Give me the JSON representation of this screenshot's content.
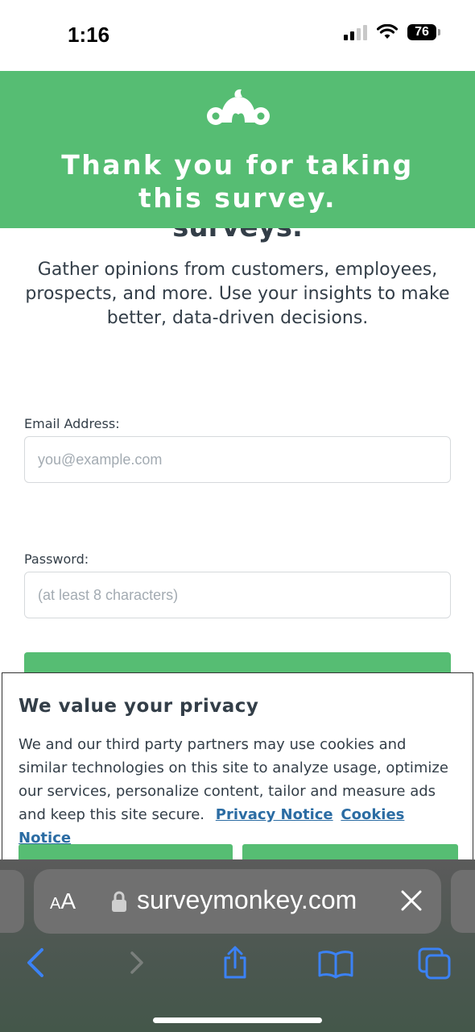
{
  "status_bar": {
    "time": "1:16",
    "battery": "76"
  },
  "header": {
    "title": "Thank you for taking this survey."
  },
  "page": {
    "cutoff_heading": "surveys.",
    "intro": "Gather opinions from customers, employees, prospects, and more. Use your insights to make better, data-driven decisions.",
    "email": {
      "label": "Email Address:",
      "placeholder": "you@example.com"
    },
    "password": {
      "label": "Password:",
      "placeholder": "(at least 8 characters)"
    }
  },
  "privacy": {
    "title": "We value your privacy",
    "body": "We and our third party partners may use cookies and similar technologies on this site to analyze usage, optimize our services, personalize content, tailor and measure ads and keep this site secure.",
    "privacy_link": "Privacy Notice",
    "cookies_link": "Cookies Notice"
  },
  "browser": {
    "aa_small": "A",
    "aa_large": "A",
    "url": "surveymonkey.com",
    "icons": [
      "back-icon",
      "forward-icon",
      "share-icon",
      "bookmarks-icon",
      "tabs-icon",
      "lock-icon",
      "clear-icon"
    ]
  },
  "colors": {
    "brand_green": "#56bd73",
    "text": "#333e48",
    "link": "#2b6ca3"
  }
}
